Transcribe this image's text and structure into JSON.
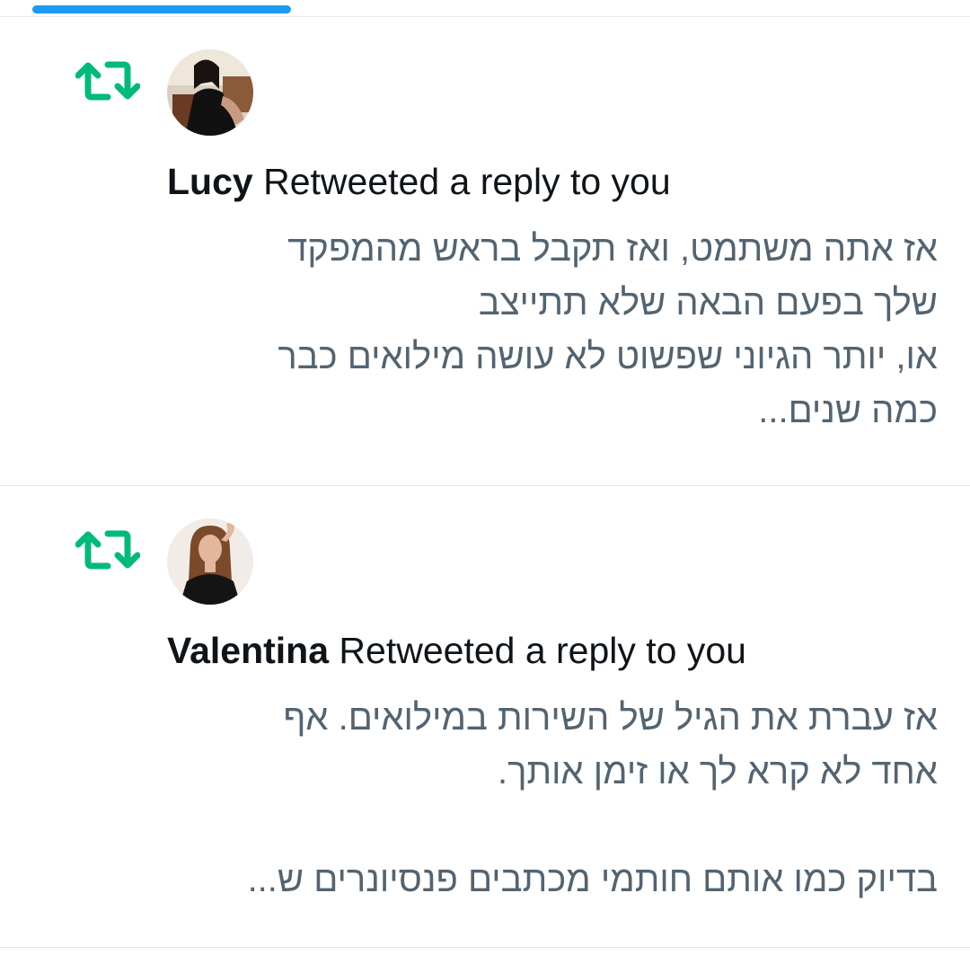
{
  "colors": {
    "accent": "#1d9bf0",
    "retweet_green": "#00ba7c",
    "primary_text": "#0f1419",
    "secondary_text": "#536471",
    "divider": "#dfe3e6"
  },
  "notifications": [
    {
      "icon": "retweet-icon",
      "avatar": "user-avatar",
      "user": "Lucy",
      "action": "Retweeted a reply to you",
      "text_lines": [
        "אז אתה משתמט, ואז תקבל בראש מהמפקד",
        "שלך בפעם הבאה שלא תתייצב",
        "או, יותר הגיוני שפשוט לא עושה מילואים כבר",
        "כמה שנים..."
      ]
    },
    {
      "icon": "retweet-icon",
      "avatar": "user-avatar",
      "user": "Valentina",
      "action": "Retweeted a reply to you",
      "text_lines": [
        "אז עברת את הגיל של השירות במילואים. אף",
        "אחד לא קרא לך או זימן אותך.",
        "",
        "בדיוק כמו אותם חותמי מכתבים פנסיונרים ש..."
      ]
    }
  ]
}
